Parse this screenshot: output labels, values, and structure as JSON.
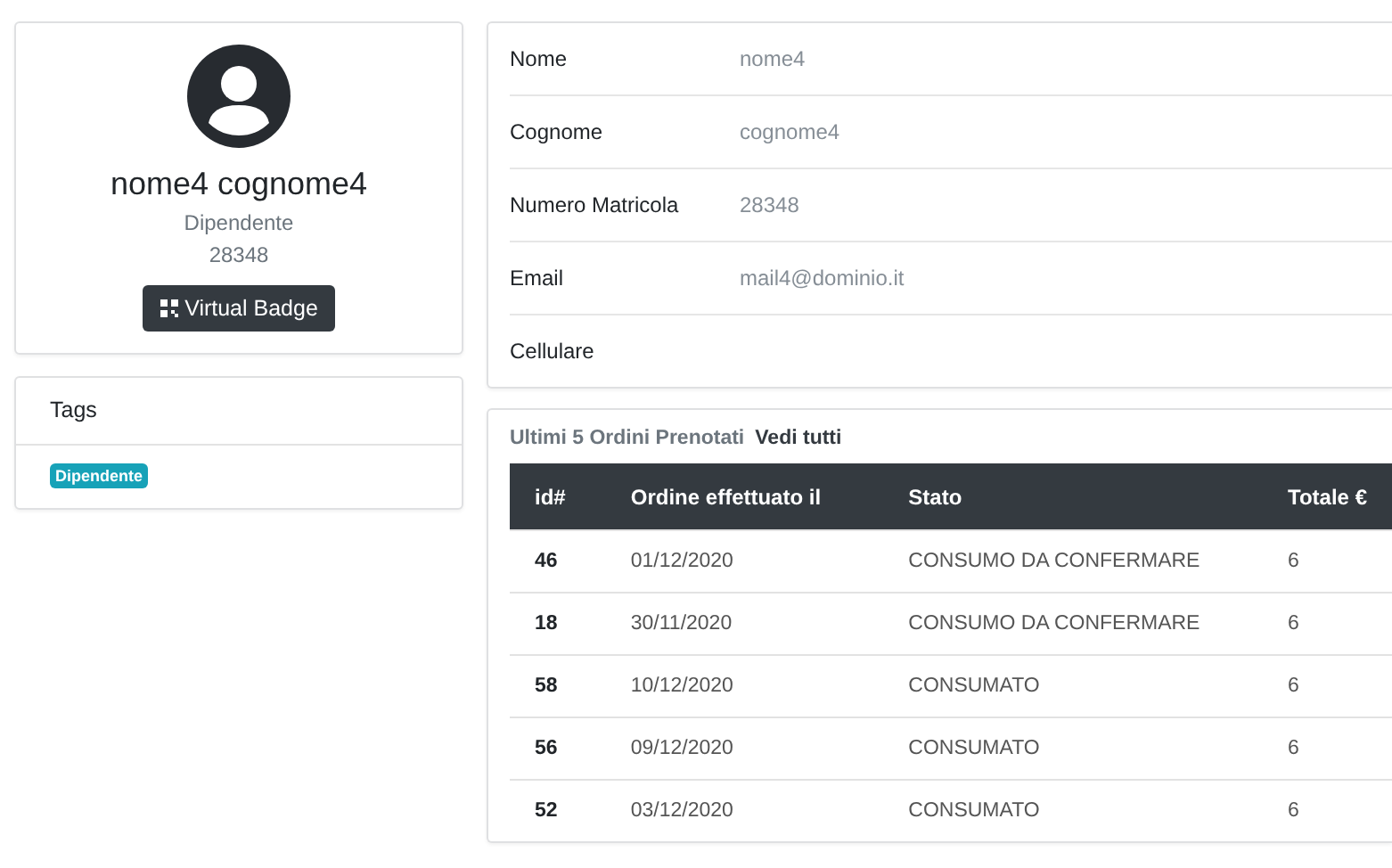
{
  "profile": {
    "name": "nome4 cognome4",
    "role": "Dipendente",
    "number": "28348",
    "badge_button": "Virtual Badge"
  },
  "tags": {
    "title": "Tags",
    "items": [
      {
        "label": "Dipendente",
        "color": "#17a2b8"
      }
    ]
  },
  "details": [
    {
      "label": "Nome",
      "value": "nome4"
    },
    {
      "label": "Cognome",
      "value": "cognome4"
    },
    {
      "label": "Numero Matricola",
      "value": "28348"
    },
    {
      "label": "Email",
      "value": "mail4@dominio.it"
    },
    {
      "label": "Cellulare"
    }
  ],
  "orders": {
    "title": "Ultimi 5 Ordini Prenotati",
    "link": "Vedi tutti",
    "columns": [
      "id#",
      "Ordine effettuato il",
      "Stato",
      "Totale €"
    ],
    "rows": [
      [
        "46",
        "01/12/2020",
        "CONSUMO DA CONFERMARE",
        "6"
      ],
      [
        "18",
        "30/11/2020",
        "CONSUMO DA CONFERMARE",
        "6"
      ],
      [
        "58",
        "10/12/2020",
        "CONSUMATO",
        "6"
      ],
      [
        "56",
        "09/12/2020",
        "CONSUMATO",
        "6"
      ],
      [
        "52",
        "03/12/2020",
        "CONSUMATO",
        "6"
      ]
    ]
  }
}
